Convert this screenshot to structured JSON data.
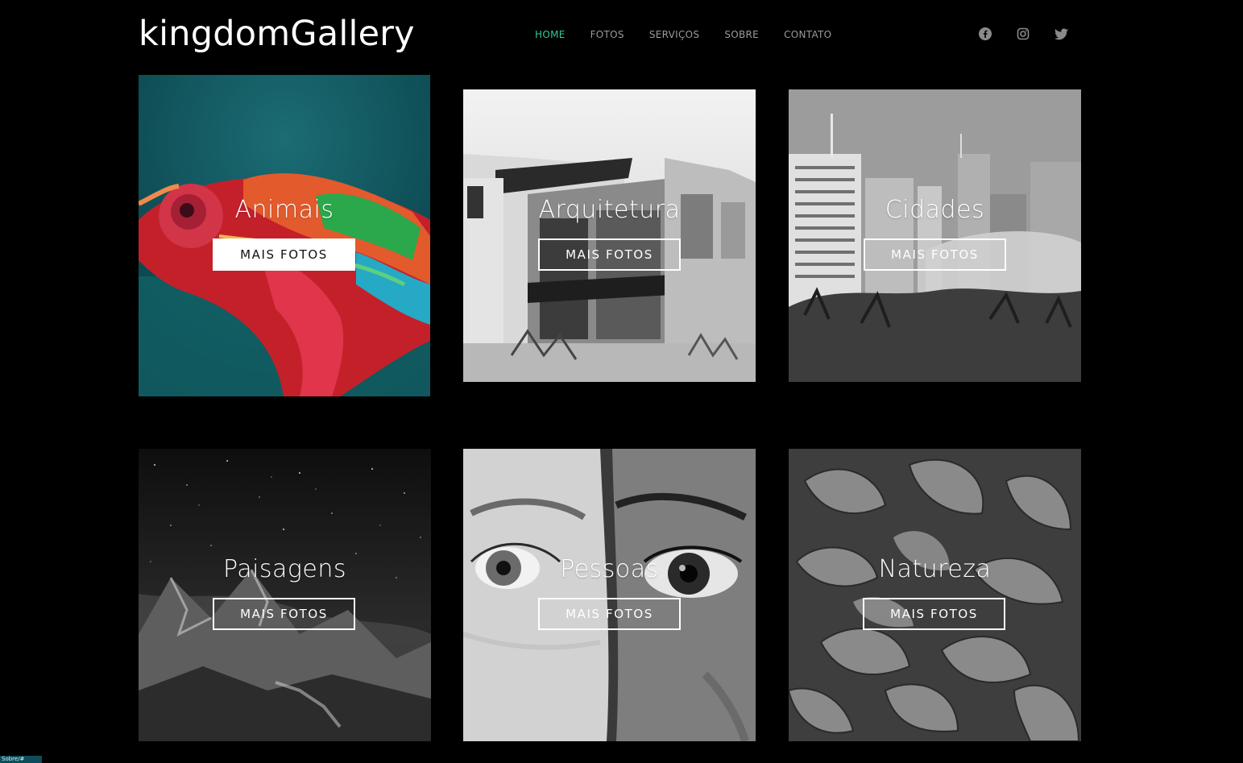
{
  "brand": {
    "logo": "kingdomGallery",
    "accent": "#2ecc8f"
  },
  "nav": [
    {
      "label": "HOME",
      "active": true
    },
    {
      "label": "FOTOS",
      "active": false
    },
    {
      "label": "SERVIÇOS",
      "active": false
    },
    {
      "label": "SOBRE",
      "active": false
    },
    {
      "label": "CONTATO",
      "active": false
    }
  ],
  "social": [
    {
      "icon": "facebook-icon"
    },
    {
      "icon": "instagram-icon"
    },
    {
      "icon": "twitter-icon"
    }
  ],
  "tiles": [
    {
      "title": "Animais",
      "button": "MAIS FOTOS",
      "image": "colorful chameleon"
    },
    {
      "title": "Arquitetura",
      "button": "MAIS FOTOS",
      "image": "modern building"
    },
    {
      "title": "Cidades",
      "button": "MAIS FOTOS",
      "image": "city skyscrapers"
    },
    {
      "title": "Paisagens",
      "button": "MAIS FOTOS",
      "image": "starry mountains"
    },
    {
      "title": "Pessoas",
      "button": "MAIS FOTOS",
      "image": "two faces eyes"
    },
    {
      "title": "Natureza",
      "button": "MAIS FOTOS",
      "image": "leaves"
    }
  ],
  "status_bar": {
    "text": "Sobre/#"
  }
}
